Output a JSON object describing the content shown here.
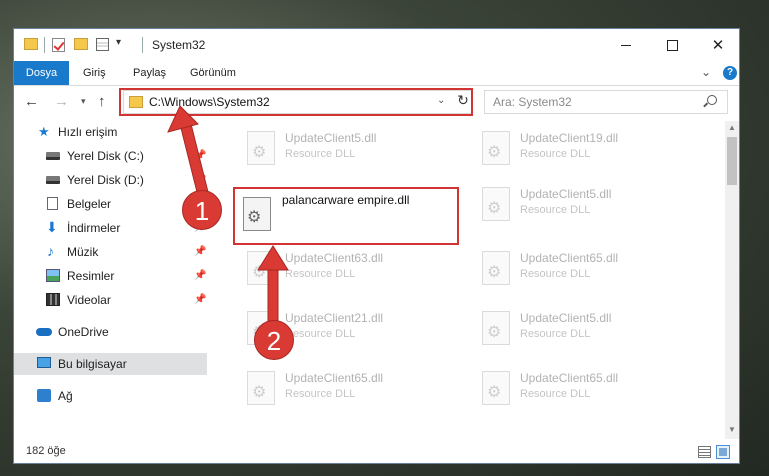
{
  "window": {
    "title": "System32"
  },
  "ribbon": {
    "tabs": [
      "Dosya",
      "Giriş",
      "Paylaş",
      "Görünüm"
    ],
    "help_label": "?"
  },
  "address": {
    "path": "C:\\Windows\\System32",
    "search_placeholder": "Ara: System32"
  },
  "sidebar": {
    "items": [
      {
        "label": "Hızlı erişim"
      },
      {
        "label": "Yerel Disk (C:)"
      },
      {
        "label": "Yerel Disk (D:)"
      },
      {
        "label": "Belgeler"
      },
      {
        "label": "İndirmeler"
      },
      {
        "label": "Müzik"
      },
      {
        "label": "Resimler"
      },
      {
        "label": "Videolar"
      },
      {
        "label": "OneDrive"
      },
      {
        "label": "Bu bilgisayar"
      },
      {
        "label": "Ağ"
      }
    ]
  },
  "files": [
    {
      "name": "UpdateClient5.dll",
      "type": "Resource DLL"
    },
    {
      "name": "UpdateClient19.dll",
      "type": "Resource DLL"
    },
    {
      "name": "palancarware empire.dll",
      "type": ""
    },
    {
      "name": "UpdateClient5.dll",
      "type": "Resource DLL"
    },
    {
      "name": "UpdateClient63.dll",
      "type": "Resource DLL"
    },
    {
      "name": "UpdateClient65.dll",
      "type": "Resource DLL"
    },
    {
      "name": "UpdateClient21.dll",
      "type": "Resource DLL"
    },
    {
      "name": "UpdateClient5.dll",
      "type": "Resource DLL"
    },
    {
      "name": "UpdateClient65.dll",
      "type": "Resource DLL"
    },
    {
      "name": "UpdateClient65.dll",
      "type": "Resource DLL"
    }
  ],
  "status": {
    "count": "182 öğe"
  },
  "annotations": {
    "badge1": "1",
    "badge2": "2",
    "color": "#d93b34"
  }
}
